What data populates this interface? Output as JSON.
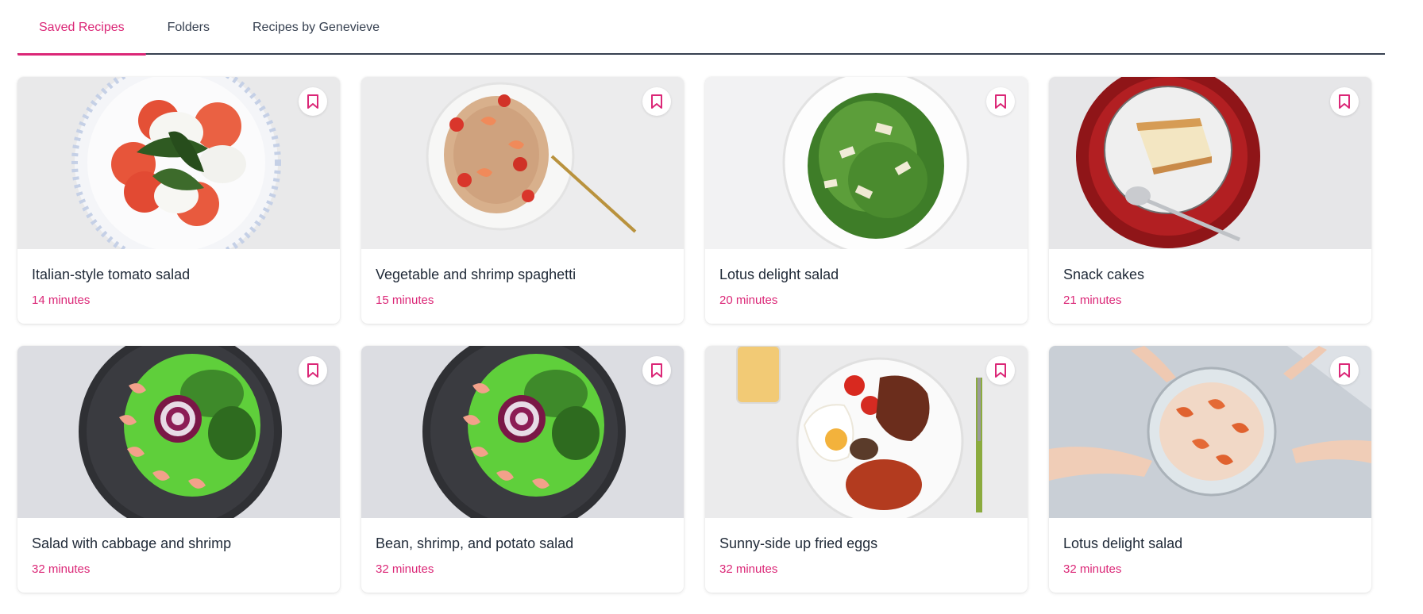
{
  "tabs": [
    {
      "label": "Saved Recipes",
      "active": true
    },
    {
      "label": "Folders",
      "active": false
    },
    {
      "label": "Recipes by Genevieve",
      "active": false
    }
  ],
  "accent_color": "#db2777",
  "bookmark_icon": "bookmark-icon",
  "recipes": [
    {
      "title": "Italian-style tomato salad",
      "time": "14 minutes",
      "image": "caprese-salad-photo"
    },
    {
      "title": "Vegetable and shrimp spaghetti",
      "time": "15 minutes",
      "image": "shrimp-spaghetti-photo"
    },
    {
      "title": "Lotus delight salad",
      "time": "20 minutes",
      "image": "green-bean-salad-photo"
    },
    {
      "title": "Snack cakes",
      "time": "21 minutes",
      "image": "cake-slice-photo"
    },
    {
      "title": "Salad with cabbage and shrimp",
      "time": "32 minutes",
      "image": "shrimp-salad-bowl-photo"
    },
    {
      "title": "Bean, shrimp, and potato salad",
      "time": "32 minutes",
      "image": "shrimp-salad-bowl-photo"
    },
    {
      "title": "Sunny-side up fried eggs",
      "time": "32 minutes",
      "image": "breakfast-plate-photo"
    },
    {
      "title": "Lotus delight salad",
      "time": "32 minutes",
      "image": "shared-shrimp-dish-photo"
    }
  ]
}
